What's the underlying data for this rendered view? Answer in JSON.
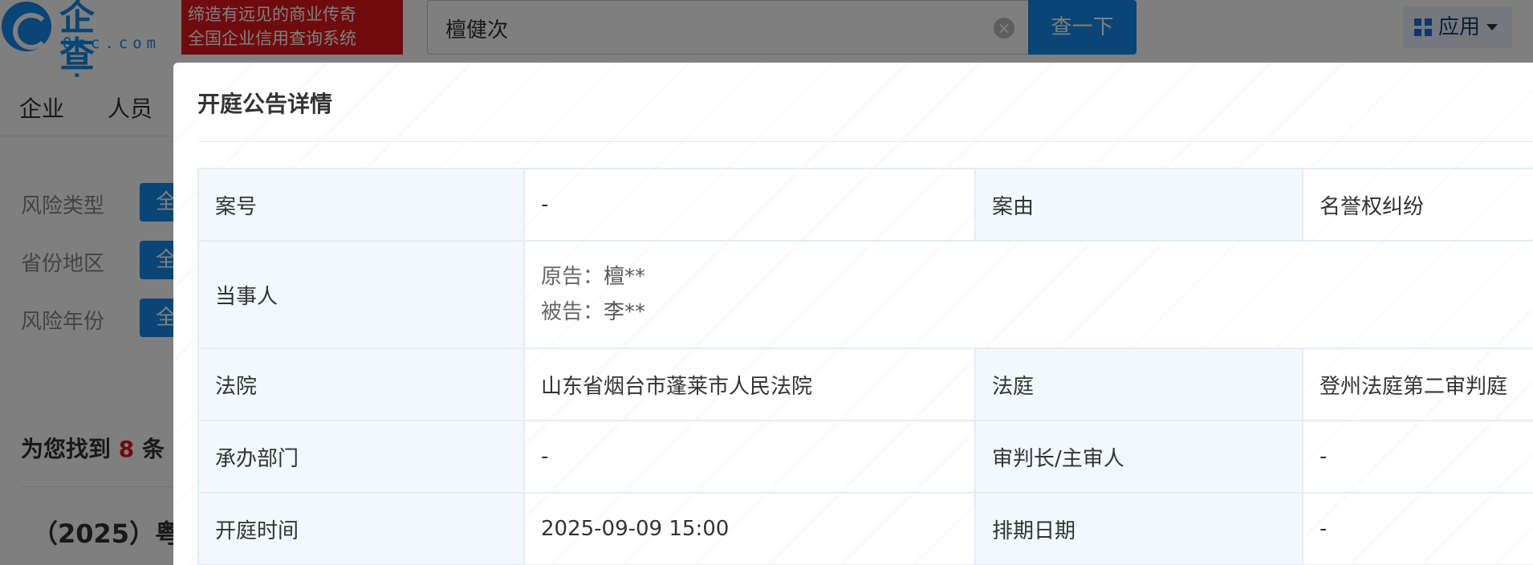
{
  "header": {
    "logo_cn": "企查查",
    "logo_en": "Qcc.com",
    "slogan_line1": "缔造有远见的商业传奇",
    "slogan_line2": "全国企业信用查询系统",
    "search_value": "檀健次",
    "search_button": "查一下",
    "apps_label": "应用"
  },
  "nav": {
    "items": [
      {
        "label": "企业"
      },
      {
        "label": "人员"
      }
    ]
  },
  "filters": {
    "rows": [
      {
        "label": "风险类型",
        "chip": "全"
      },
      {
        "label": "省份地区",
        "chip": "全"
      },
      {
        "label": "风险年份",
        "chip": "全"
      }
    ]
  },
  "results": {
    "prefix": "为您找到",
    "count": "8",
    "suffix": "条",
    "first_case_title": "（2025）粤"
  },
  "modal": {
    "title": "开庭公告详情",
    "rows": [
      {
        "label1": "案号",
        "value1": "-",
        "label2": "案由",
        "value2": "名誉权纠纷"
      },
      {
        "label1": "法院",
        "value1": "山东省烟台市蓬莱市人民法院",
        "label2": "法庭",
        "value2": "登州法庭第二审判庭"
      },
      {
        "label1": "承办部门",
        "value1": "-",
        "label2": "审判长/主审人",
        "value2": "-"
      },
      {
        "label1": "开庭时间",
        "value1": "2025-09-09 15:00",
        "label2": "排期日期",
        "value2": "-"
      }
    ],
    "party": {
      "label": "当事人",
      "plaintiff_label": "原告：",
      "plaintiff_value": "檀**",
      "defendant_label": "被告：",
      "defendant_value": "李**"
    }
  },
  "colors": {
    "brand_blue": "#128bed",
    "slogan_red": "#e0171c",
    "label_bg": "#f2f8fd",
    "border": "#e4ecf5"
  }
}
